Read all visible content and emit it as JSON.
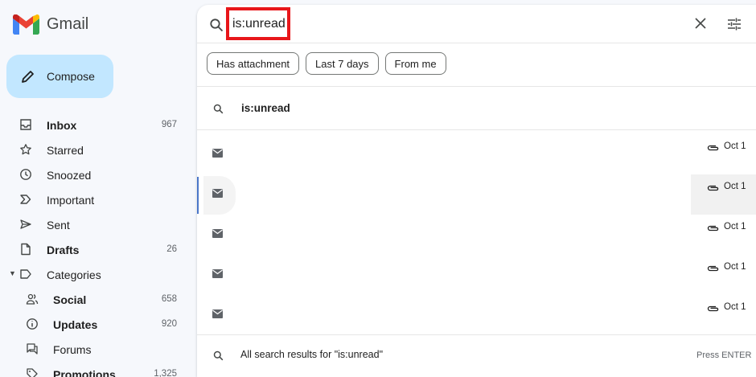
{
  "app": {
    "name": "Gmail"
  },
  "compose": {
    "label": "Compose"
  },
  "sidebar": {
    "items": [
      {
        "label": "Inbox",
        "count": "967",
        "icon": "inbox-icon",
        "bold": true
      },
      {
        "label": "Starred",
        "count": "",
        "icon": "star-icon",
        "bold": false
      },
      {
        "label": "Snoozed",
        "count": "",
        "icon": "clock-icon",
        "bold": false
      },
      {
        "label": "Important",
        "count": "",
        "icon": "important-icon",
        "bold": false
      },
      {
        "label": "Sent",
        "count": "",
        "icon": "send-icon",
        "bold": false
      },
      {
        "label": "Drafts",
        "count": "26",
        "icon": "file-icon",
        "bold": true
      },
      {
        "label": "Categories",
        "count": "",
        "icon": "label-icon",
        "bold": false
      },
      {
        "label": "Social",
        "count": "658",
        "icon": "people-icon",
        "bold": true
      },
      {
        "label": "Updates",
        "count": "920",
        "icon": "info-icon",
        "bold": true
      },
      {
        "label": "Forums",
        "count": "",
        "icon": "forum-icon",
        "bold": false
      },
      {
        "label": "Promotions",
        "count": "1,325",
        "icon": "tag-icon",
        "bold": true
      }
    ]
  },
  "search": {
    "query": "is:unread",
    "chips": [
      "Has attachment",
      "Last 7 days",
      "From me"
    ],
    "suggestion": "is:unread",
    "results": [
      {
        "date": "Oct 1"
      },
      {
        "date": "Oct 1"
      },
      {
        "date": "Oct 1"
      },
      {
        "date": "Oct 1"
      },
      {
        "date": "Oct 1"
      }
    ],
    "all_results_label": "All search results for \"is:unread\"",
    "enter_hint": "Press ENTER"
  },
  "colors": {
    "compose_bg": "#c2e7ff",
    "highlight_box": "#e8161a",
    "active_indicator": "#4a76c9"
  }
}
